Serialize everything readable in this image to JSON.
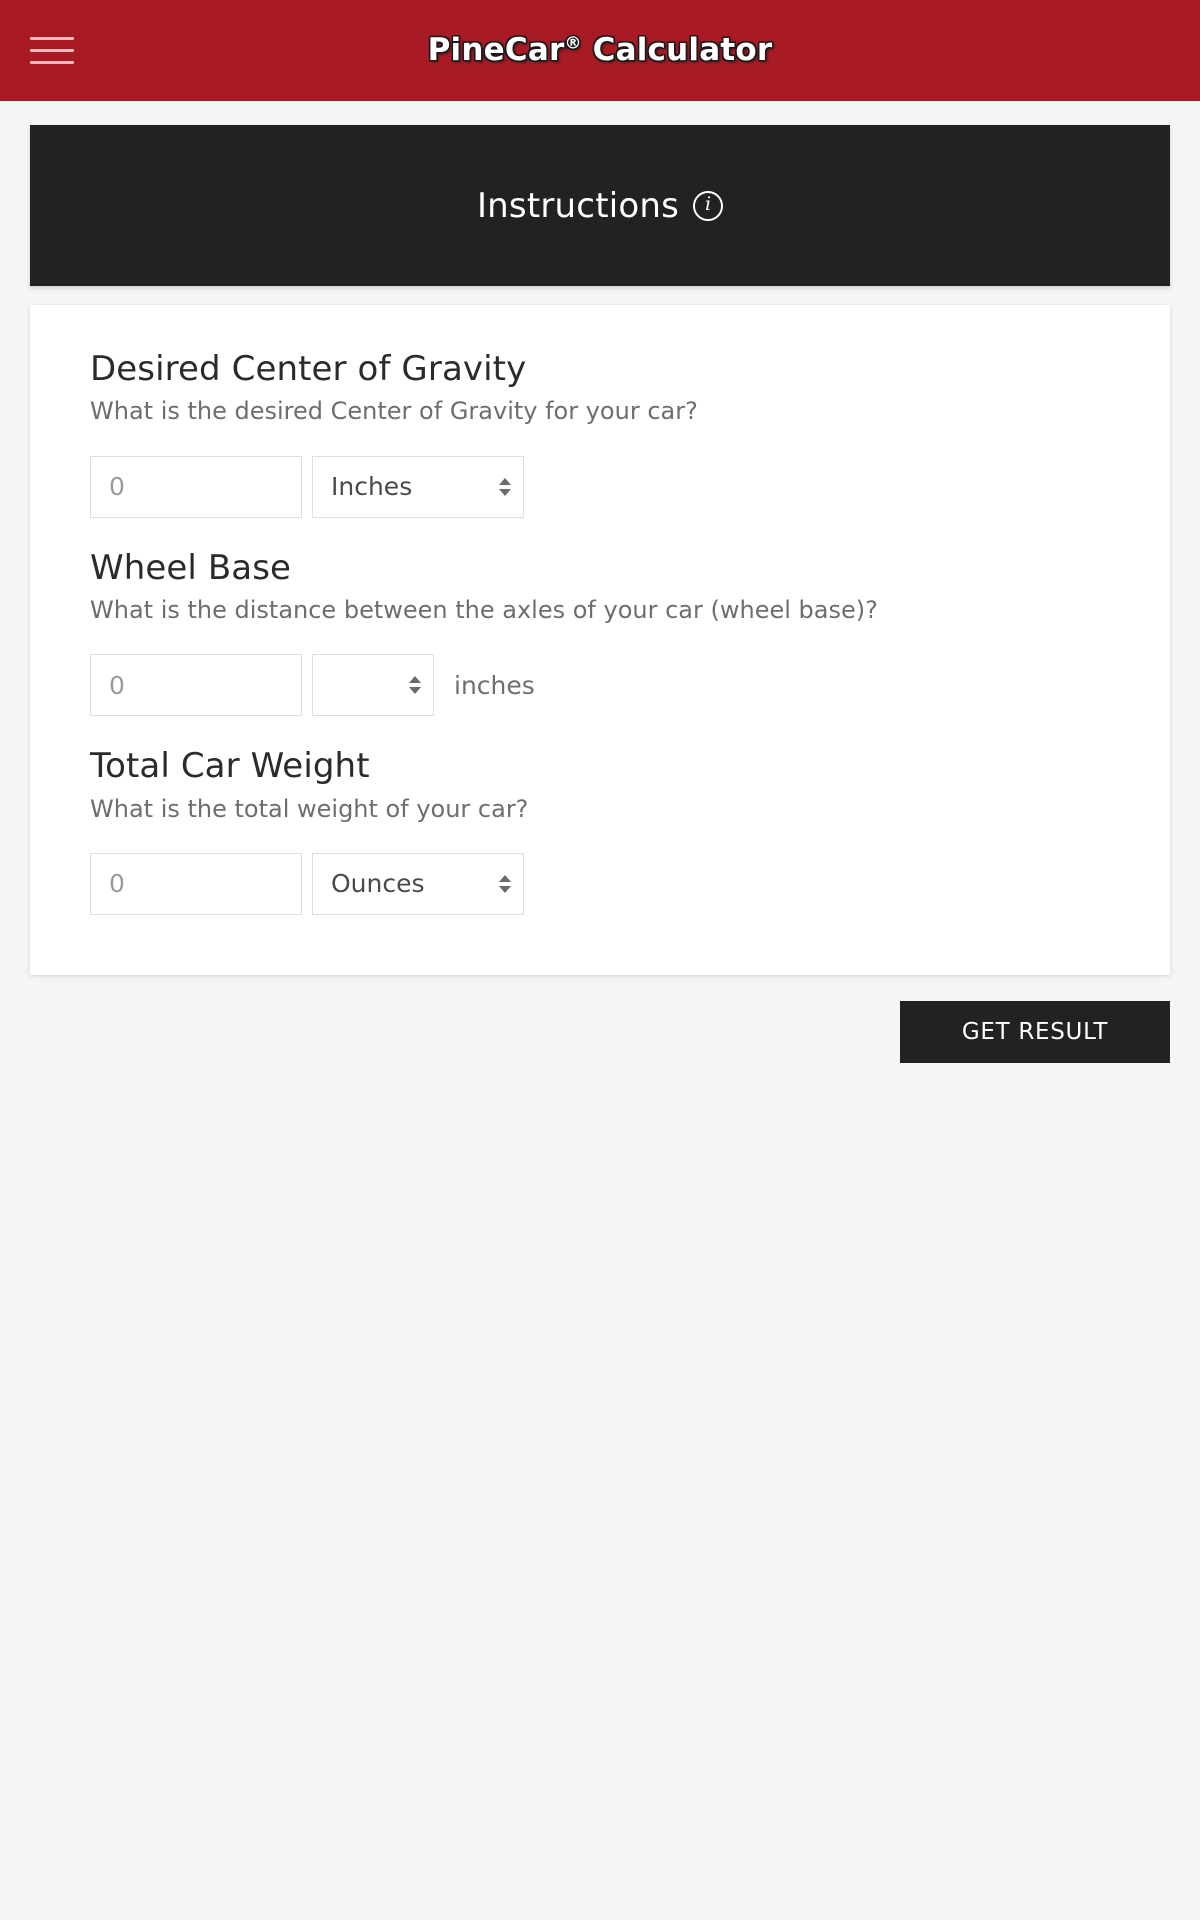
{
  "appbar": {
    "menu_icon": "hamburger-menu-icon",
    "title_main": "PineCar",
    "title_sup": "®",
    "title_rest": " Calculator",
    "background_color": "#a91b24",
    "title_color": "#ffffff"
  },
  "instructions": {
    "label": "Instructions",
    "icon": "info-circle-icon",
    "icon_glyph": "i",
    "background_color": "#222222"
  },
  "form": {
    "fields": [
      {
        "title": "Desired Center of Gravity",
        "question": "What is the desired Center of Gravity for your car?",
        "input_value": "",
        "input_placeholder": "0",
        "unit_selected": "Inches",
        "unit_suffix": ""
      },
      {
        "title": "Wheel Base",
        "question": "What is the distance between the axles of your car (wheel base)?",
        "input_value": "",
        "input_placeholder": "0",
        "unit_selected": "",
        "unit_suffix": "inches"
      },
      {
        "title": "Total Car Weight",
        "question": "What is the total weight of your car?",
        "input_value": "",
        "input_placeholder": "0",
        "unit_selected": "Ounces",
        "unit_suffix": ""
      }
    ]
  },
  "actions": {
    "get_result_label": "GET RESULT",
    "get_result_color": "#222222"
  }
}
